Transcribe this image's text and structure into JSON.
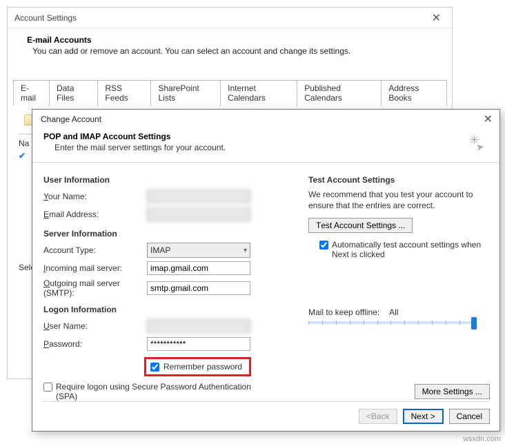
{
  "acctSettings": {
    "title": "Account Settings",
    "heading": "E-mail Accounts",
    "sub": "You can add or remove an account. You can select an account and change its settings.",
    "tabs": [
      "E-mail",
      "Data Files",
      "RSS Feeds",
      "SharePoint Lists",
      "Internet Calendars",
      "Published Calendars",
      "Address Books"
    ],
    "nameCol": "Na",
    "selLabel": "Sele"
  },
  "changeAcct": {
    "title": "Change Account",
    "heading": "POP and IMAP Account Settings",
    "sub": "Enter the mail server settings for your account.",
    "userInfoHdr": "User Information",
    "yourNameLbl": "Your Name:",
    "emailLbl": "Email Address:",
    "serverInfoHdr": "Server Information",
    "acctTypeLbl": "Account Type:",
    "acctTypeVal": "IMAP",
    "incomingLbl": "Incoming mail server:",
    "incomingVal": "imap.gmail.com",
    "outgoingLbl": "Outgoing mail server (SMTP):",
    "outgoingVal": "smtp.gmail.com",
    "logonHdr": "Logon Information",
    "userNameLbl": "User Name:",
    "passwordLbl": "Password:",
    "passwordVal": "***********",
    "rememberLbl": "Remember password",
    "spaLbl": "Require logon using Secure Password Authentication (SPA)",
    "testHdr": "Test Account Settings",
    "testDesc": "We recommend that you test your account to ensure that the entries are correct.",
    "testBtn": "Test Account Settings ...",
    "autoTestLbl": "Automatically test account settings when Next is clicked",
    "mailOfflineLbl": "Mail to keep offline:",
    "mailOfflineVal": "All",
    "moreBtn": "More Settings ...",
    "backBtn": "< Back",
    "nextBtn": "Next >",
    "cancelBtn": "Cancel"
  },
  "watermark": "wsxdn.com"
}
